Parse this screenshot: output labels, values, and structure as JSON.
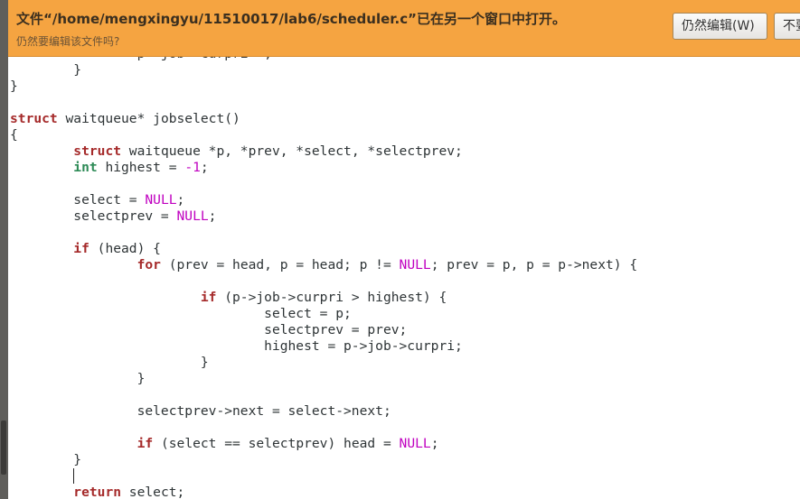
{
  "infobar": {
    "title": "文件“/home/mengxingyu/11510017/lab6/scheduler.c”已在另一个窗口中打开。",
    "subtitle": "仍然要编辑该文件吗?",
    "edit_anyway_label": "仍然编辑(W)",
    "dont_edit_label": "不要"
  },
  "code": {
    "lines": [
      [
        {
          "t": "                p->job->curpri++;",
          "c": ""
        }
      ],
      [
        {
          "t": "        }",
          "c": ""
        }
      ],
      [
        {
          "t": "}",
          "c": ""
        }
      ],
      [
        {
          "t": "",
          "c": ""
        }
      ],
      [
        {
          "t": "struct",
          "c": "kw"
        },
        {
          "t": " waitqueue* jobselect()",
          "c": ""
        }
      ],
      [
        {
          "t": "{",
          "c": ""
        }
      ],
      [
        {
          "t": "        ",
          "c": ""
        },
        {
          "t": "struct",
          "c": "kw"
        },
        {
          "t": " waitqueue *p, *prev, *select, *selectprev;",
          "c": ""
        }
      ],
      [
        {
          "t": "        ",
          "c": ""
        },
        {
          "t": "int",
          "c": "type"
        },
        {
          "t": " highest = ",
          "c": ""
        },
        {
          "t": "-1",
          "c": "num"
        },
        {
          "t": ";",
          "c": ""
        }
      ],
      [
        {
          "t": "",
          "c": ""
        }
      ],
      [
        {
          "t": "        select = ",
          "c": ""
        },
        {
          "t": "NULL",
          "c": "const"
        },
        {
          "t": ";",
          "c": ""
        }
      ],
      [
        {
          "t": "        selectprev = ",
          "c": ""
        },
        {
          "t": "NULL",
          "c": "const"
        },
        {
          "t": ";",
          "c": ""
        }
      ],
      [
        {
          "t": "",
          "c": ""
        }
      ],
      [
        {
          "t": "        ",
          "c": ""
        },
        {
          "t": "if",
          "c": "kw"
        },
        {
          "t": " (head) {",
          "c": ""
        }
      ],
      [
        {
          "t": "                ",
          "c": ""
        },
        {
          "t": "for",
          "c": "kw"
        },
        {
          "t": " (prev = head, p = head; p != ",
          "c": ""
        },
        {
          "t": "NULL",
          "c": "const"
        },
        {
          "t": "; prev = p, p = p->next) {",
          "c": ""
        }
      ],
      [
        {
          "t": "",
          "c": ""
        }
      ],
      [
        {
          "t": "                        ",
          "c": ""
        },
        {
          "t": "if",
          "c": "kw"
        },
        {
          "t": " (p->job->curpri > highest) {",
          "c": ""
        }
      ],
      [
        {
          "t": "                                select = p;",
          "c": ""
        }
      ],
      [
        {
          "t": "                                selectprev = prev;",
          "c": ""
        }
      ],
      [
        {
          "t": "                                highest = p->job->curpri;",
          "c": ""
        }
      ],
      [
        {
          "t": "                        }",
          "c": ""
        }
      ],
      [
        {
          "t": "                }",
          "c": ""
        }
      ],
      [
        {
          "t": "",
          "c": ""
        }
      ],
      [
        {
          "t": "                selectprev->next = select->next;",
          "c": ""
        }
      ],
      [
        {
          "t": "",
          "c": ""
        }
      ],
      [
        {
          "t": "                ",
          "c": ""
        },
        {
          "t": "if",
          "c": "kw"
        },
        {
          "t": " (select == selectprev) head = ",
          "c": ""
        },
        {
          "t": "NULL",
          "c": "const"
        },
        {
          "t": ";",
          "c": ""
        }
      ],
      [
        {
          "t": "        }",
          "c": ""
        }
      ],
      [
        {
          "t": "        ",
          "c": ""
        },
        {
          "t": "",
          "c": "cursor"
        }
      ],
      [
        {
          "t": "        ",
          "c": ""
        },
        {
          "t": "return",
          "c": "kw"
        },
        {
          "t": " select;",
          "c": ""
        }
      ]
    ]
  },
  "colors": {
    "infobar": "#f5a441",
    "keyword": "#a52a2a",
    "type": "#2e8b57",
    "constant": "#c000c0"
  }
}
